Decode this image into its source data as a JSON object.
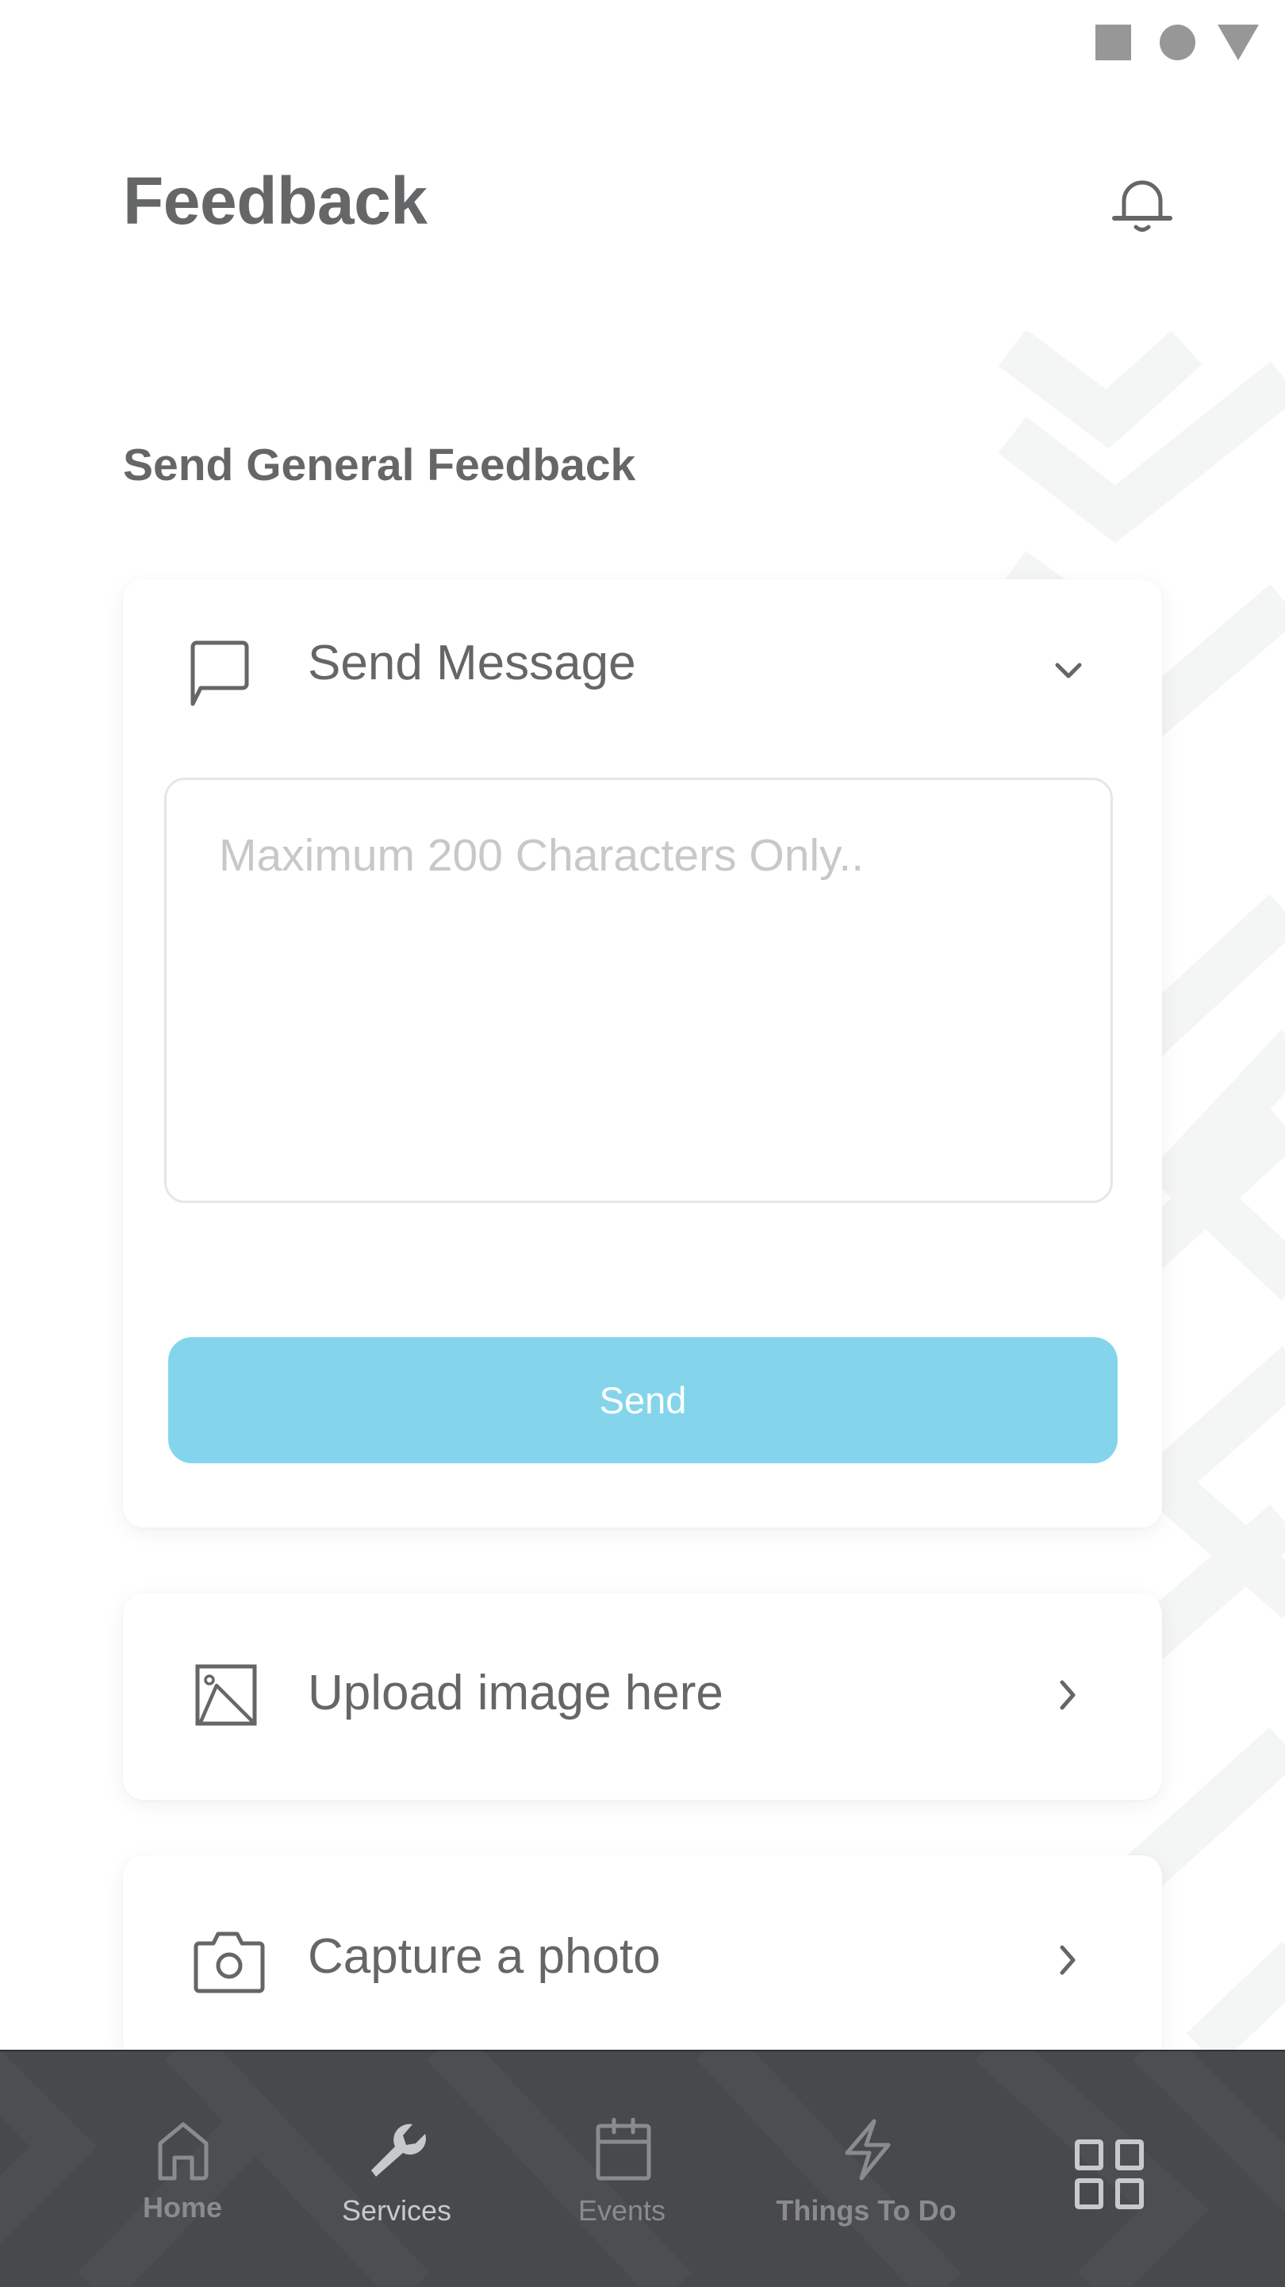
{
  "status_bar": {
    "icons": [
      "square-icon",
      "circle-icon",
      "triangle-icon"
    ]
  },
  "header": {
    "title": "Feedback",
    "notification_icon": "bell-icon"
  },
  "section": {
    "title": "Send General Feedback"
  },
  "message_card": {
    "icon": "chat-bubble-icon",
    "label": "Send Message",
    "expand_icon": "chevron-down-icon",
    "expanded": true,
    "textarea": {
      "value": "",
      "placeholder": "Maximum 200 Characters Only.."
    },
    "send_label": "Send"
  },
  "upload_card": {
    "icon": "image-icon",
    "label": "Upload image here",
    "arrow_icon": "chevron-right-icon"
  },
  "capture_card": {
    "icon": "camera-icon",
    "label": "Capture a photo",
    "arrow_icon": "chevron-right-icon"
  },
  "bottom_nav": {
    "items": [
      {
        "label": "Home",
        "icon": "home-icon",
        "active": false
      },
      {
        "label": "Services",
        "icon": "wrench-icon",
        "active": true
      },
      {
        "label": "Events",
        "icon": "calendar-icon",
        "active": false
      },
      {
        "label": "Things To Do",
        "icon": "lightning-icon",
        "active": false
      },
      {
        "label": "",
        "icon": "grid-menu-icon",
        "active": false
      }
    ]
  },
  "colors": {
    "accent": "#84d5ec",
    "text": "#656667",
    "placeholder": "#c8c8c8",
    "nav_background": "#48494b",
    "nav_active": "#c8c9cb",
    "nav_inactive": "#8a8b8c"
  }
}
